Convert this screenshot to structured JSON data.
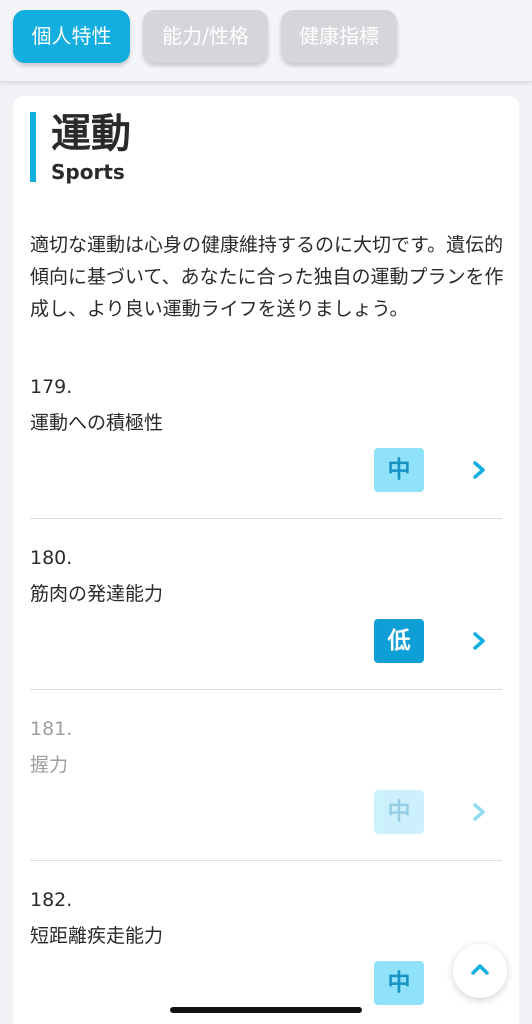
{
  "tabs": [
    {
      "label": "個人特性",
      "active": true
    },
    {
      "label": "能力/性格",
      "active": false
    },
    {
      "label": "健康指標",
      "active": false
    }
  ],
  "section": {
    "title": "運動",
    "subtitle": "Sports",
    "description": "適切な運動は心身の健康維持するのに大切です。遺伝的傾向に基づいて、あなたに合った独自の運動プランを作成し、より良い運動ライフを送りましょう。"
  },
  "items": [
    {
      "number": "179.",
      "name": "運動への積極性",
      "level": "中"
    },
    {
      "number": "180.",
      "name": "筋肉の発達能力",
      "level": "低"
    },
    {
      "number": "181.",
      "name": "握力",
      "level": "中"
    },
    {
      "number": "182.",
      "name": "短距離疾走能力",
      "level": "中"
    }
  ],
  "icons": {
    "chevron": "chevron-right-icon",
    "scroll_top": "chevron-up-icon"
  },
  "colors": {
    "accent": "#12aee0",
    "badge_mid_bg": "#8fe2f9",
    "badge_low_bg": "#0d9fd6"
  }
}
